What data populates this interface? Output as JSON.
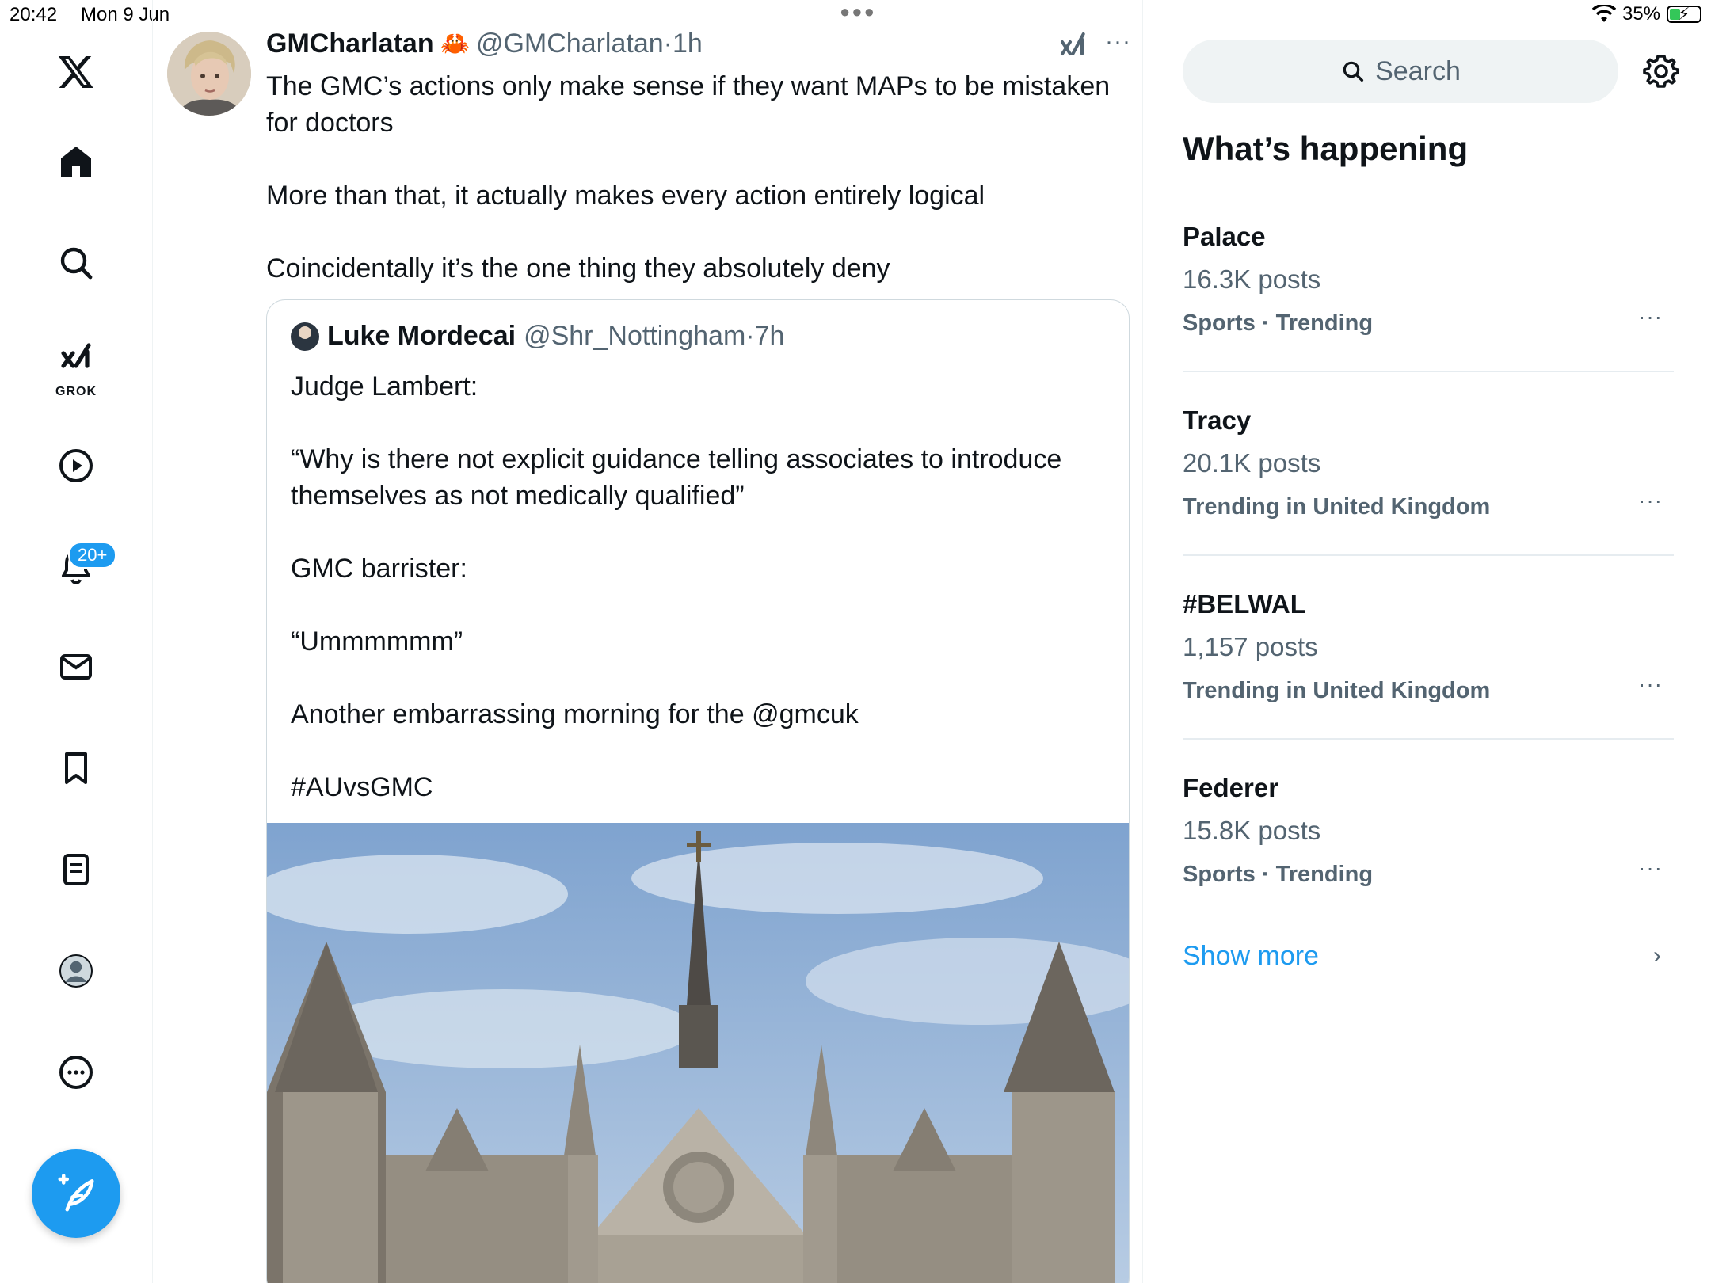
{
  "status_bar": {
    "time": "20:42",
    "date": "Mon 9 Jun",
    "battery": "35%",
    "battery_level": 0.35
  },
  "nav": {
    "items": [
      "home",
      "explore",
      "grok",
      "videos",
      "notifications",
      "messages",
      "bookmarks",
      "lists",
      "profile",
      "more"
    ],
    "grok_label": "GROK",
    "notifications_badge": "20+"
  },
  "tweet": {
    "author_name": "GMCharlatan",
    "author_emoji": "🦀",
    "handle": "@GMCharlatan",
    "separator": "·",
    "time": "1h",
    "more": "···",
    "text": [
      "The GMC’s actions only make sense if they want MAPs to be mistaken for doctors",
      "More than that, it actually makes every action entirely logical",
      "Coincidentally it’s the one thing they absolutely deny"
    ],
    "quote": {
      "author_name": "Luke Mordecai",
      "handle": "@Shr_Nottingham",
      "separator": "·",
      "time": "7h",
      "lines": [
        "Judge Lambert:",
        "“Why is there not explicit guidance telling associates to introduce themselves as not medically qualified”",
        "GMC barrister:",
        "“Ummmmmm”",
        "Another embarrassing morning for the @gmcuk",
        "#AUvsGMC"
      ]
    }
  },
  "sidebar": {
    "search_placeholder": "Search",
    "section_title": "What’s happening",
    "trends": [
      {
        "name": "Palace",
        "count": "16.3K posts",
        "context": "Sports · Trending"
      },
      {
        "name": "Tracy",
        "count": "20.1K posts",
        "context": "Trending in United Kingdom"
      },
      {
        "name": "#BELWAL",
        "count": "1,157 posts",
        "context": "Trending in United Kingdom"
      },
      {
        "name": "Federer",
        "count": "15.8K posts",
        "context": "Sports · Trending"
      }
    ],
    "trend_more": "···",
    "show_more": "Show more"
  },
  "colors": {
    "accent": "#1d9bf0",
    "text_primary": "#0f1419",
    "text_secondary": "#536471",
    "border": "#cfd9de"
  }
}
